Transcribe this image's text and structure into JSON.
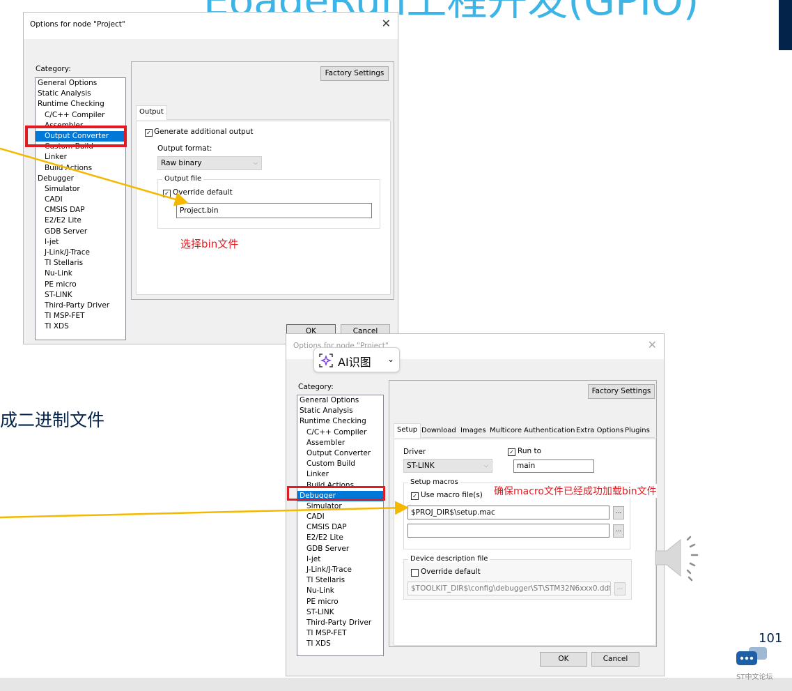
{
  "slide": {
    "title": "EoadeRun工程开发(GPIO)",
    "side_text": "成二进制文件",
    "page_number": "101",
    "watermark": "ST中文论坛",
    "accent_color": "#3cb4e6",
    "navy_color": "#03234b"
  },
  "dialog1": {
    "title": "Options for node \"Project\"",
    "category_label": "Category:",
    "categories": [
      "General Options",
      "Static Analysis",
      "Runtime Checking",
      "C/C++ Compiler",
      "Assembler",
      "Output Converter",
      "Custom Build",
      "Linker",
      "Build Actions",
      "Debugger",
      "Simulator",
      "CADI",
      "CMSIS DAP",
      "E2/E2 Lite",
      "GDB Server",
      "I-jet",
      "J-Link/J-Trace",
      "TI Stellaris",
      "Nu-Link",
      "PE micro",
      "ST-LINK",
      "Third-Party Driver",
      "TI MSP-FET",
      "TI XDS"
    ],
    "selected_category": "Output Converter",
    "factory_button": "Factory Settings",
    "tab": "Output",
    "generate_output_label": "Generate additional output",
    "generate_output_checked": true,
    "format_label": "Output format:",
    "format_value": "Raw binary",
    "output_file_group": "Output file",
    "override_label": "Override default",
    "override_checked": true,
    "file_value": "Project.bin",
    "ok_button": "OK",
    "cancel_button": "Cancel",
    "annotation": "选择bin文件"
  },
  "dialog2": {
    "title": "Options for node \"Project\"",
    "category_label": "Category:",
    "categories": [
      "General Options",
      "Static Analysis",
      "Runtime Checking",
      "C/C++ Compiler",
      "Assembler",
      "Output Converter",
      "Custom Build",
      "Linker",
      "Build Actions",
      "Debugger",
      "Simulator",
      "CADI",
      "CMSIS DAP",
      "E2/E2 Lite",
      "GDB Server",
      "I-jet",
      "J-Link/J-Trace",
      "TI Stellaris",
      "Nu-Link",
      "PE micro",
      "ST-LINK",
      "Third-Party Driver",
      "TI MSP-FET",
      "TI XDS"
    ],
    "selected_category": "Debugger",
    "factory_button": "Factory Settings",
    "tabs": [
      "Setup",
      "Download",
      "Images",
      "Multicore",
      "Authentication",
      "Extra Options",
      "Plugins"
    ],
    "active_tab": "Setup",
    "driver_label": "Driver",
    "driver_value": "ST-LINK",
    "run_to_label": "Run to",
    "run_to_checked": true,
    "run_to_value": "main",
    "setup_macros_group": "Setup macros",
    "use_macro_label": "Use macro file(s)",
    "use_macro_checked": true,
    "macro_file_1": "$PROJ_DIR$\\setup.mac",
    "macro_file_2": "",
    "browse_label": "...",
    "device_group": "Device description file",
    "device_override_label": "Override default",
    "device_override_checked": false,
    "device_file": "$TOOLKIT_DIR$\\config\\debugger\\ST\\STM32N6xxx0.ddf",
    "ok_button": "OK",
    "cancel_button": "Cancel",
    "annotation": "确保macro文件已经成功加载bin文件"
  },
  "ai_button": {
    "label": "AI识图"
  }
}
